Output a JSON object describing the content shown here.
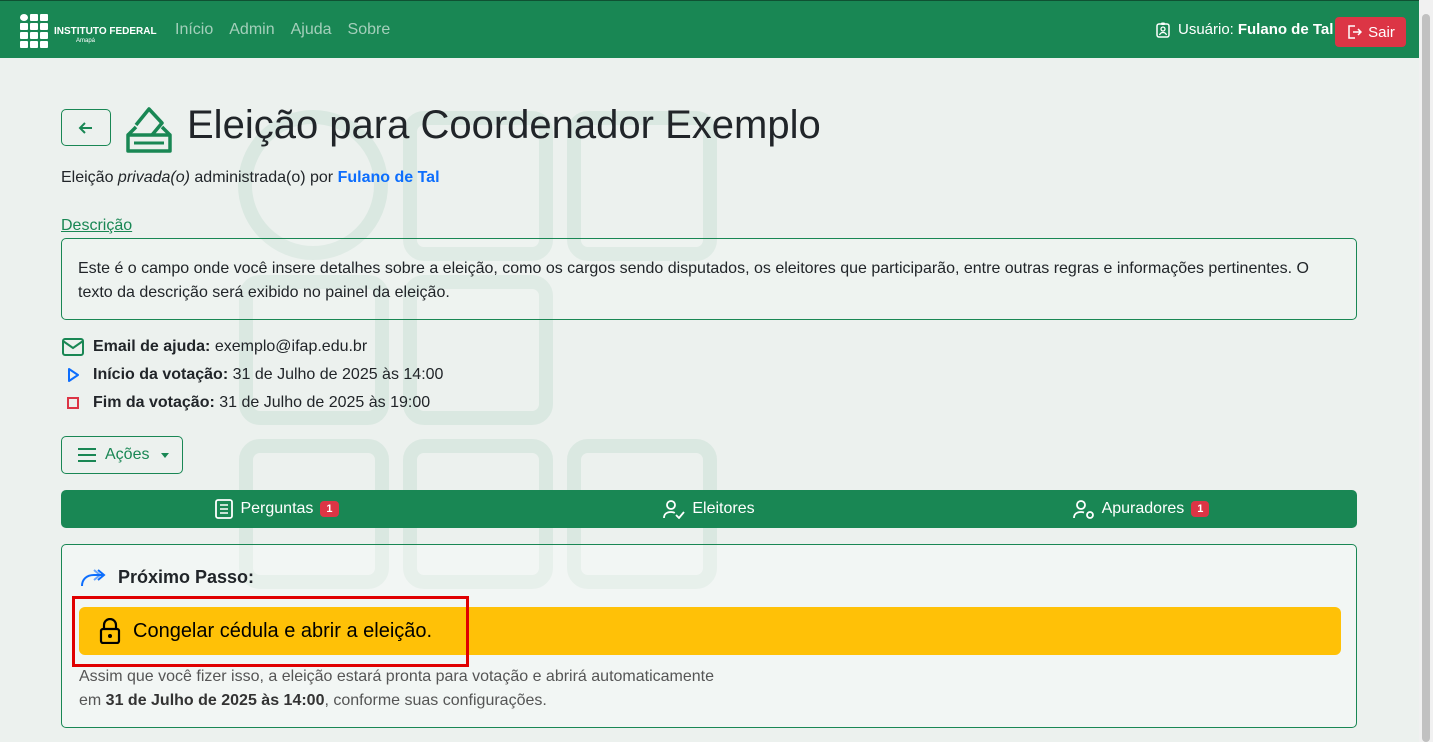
{
  "navbar": {
    "logo_text": "INSTITUTO FEDERAL",
    "logo_sub": "Amapá",
    "links": [
      "Início",
      "Admin",
      "Ajuda",
      "Sobre"
    ],
    "user_label": "Usuário:",
    "user_name": "Fulano de Tal",
    "logout_label": "Sair"
  },
  "header": {
    "title": "Eleição para Coordenador Exemplo",
    "subline_prefix": "Eleição ",
    "subline_type": "privada(o)",
    "subline_middle": " administrada(o) por ",
    "subline_admin": "Fulano de Tal"
  },
  "description": {
    "link": "Descrição",
    "text": "Este é o campo onde você insere detalhes sobre a eleição, como os cargos sendo disputados, os eleitores que participarão, entre outras regras e informações pertinentes. O texto da descrição será exibido no painel da eleição."
  },
  "info": {
    "email_label": "Email de ajuda:",
    "email_value": "exemplo@ifap.edu.br",
    "start_label": "Início da votação:",
    "start_value": "31 de Julho de 2025 às 14:00",
    "end_label": "Fim da votação:",
    "end_value": "31 de Julho de 2025 às 19:00"
  },
  "actions_label": "Ações",
  "tabs": [
    {
      "label": "Perguntas",
      "badge": "1"
    },
    {
      "label": "Eleitores",
      "badge": ""
    },
    {
      "label": "Apuradores",
      "badge": "1"
    }
  ],
  "next_step": {
    "title": "Próximo Passo:",
    "button": "Congelar cédula e abrir a eleição.",
    "note_line1": "Assim que você fizer isso, a eleição estará pronta para votação e abrirá automaticamente",
    "note_prefix": "em ",
    "note_date": "31 de Julho de 2025 às 14:00",
    "note_suffix": ", conforme suas configurações."
  },
  "colors": {
    "primary": "#198754",
    "danger": "#dc3545",
    "warning": "#ffc107",
    "link": "#0d6efd"
  }
}
